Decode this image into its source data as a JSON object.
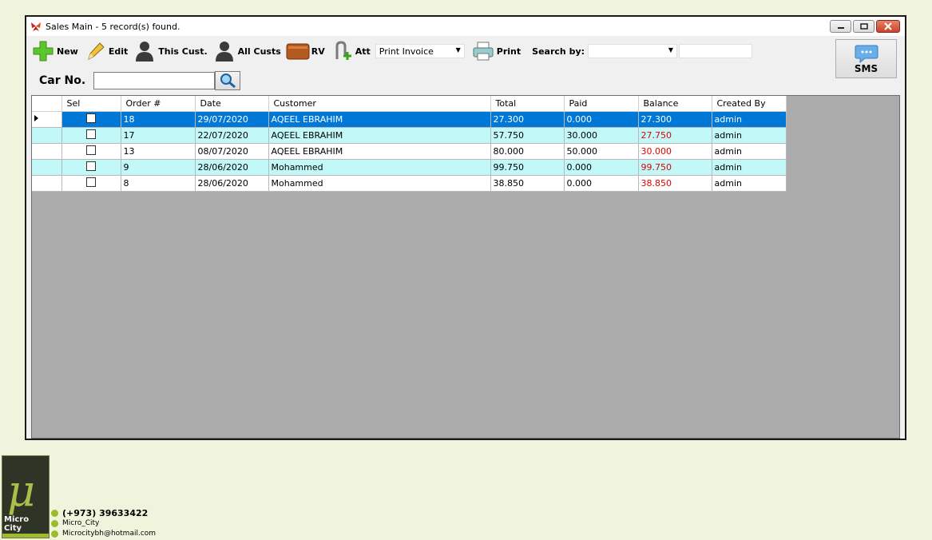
{
  "window": {
    "title": "Sales Main - 5 record(s) found."
  },
  "toolbar": {
    "new_label": "New",
    "edit_label": "Edit",
    "this_cust_label": "This Cust.",
    "all_custs_label": "All Custs",
    "rv_label": "RV",
    "att_label": "Att",
    "print_combo_value": "Print Invoice",
    "print_label": "Print",
    "search_by_label": "Search by:",
    "search_by_value": "",
    "search_value": ""
  },
  "sms": {
    "label": "SMS"
  },
  "carno": {
    "label": "Car No.",
    "value": ""
  },
  "grid": {
    "columns": [
      "Sel",
      "Order #",
      "Date",
      "Customer",
      "Total",
      "Paid",
      "Balance",
      "Created By"
    ],
    "rows": [
      {
        "order": "18",
        "date": "29/07/2020",
        "customer": "AQEEL EBRAHIM",
        "total": "27.300",
        "paid": "0.000",
        "balance": "27.300",
        "created_by": "admin"
      },
      {
        "order": "17",
        "date": "22/07/2020",
        "customer": "AQEEL EBRAHIM",
        "total": "57.750",
        "paid": "30.000",
        "balance": "27.750",
        "created_by": "admin"
      },
      {
        "order": "13",
        "date": "08/07/2020",
        "customer": "AQEEL EBRAHIM",
        "total": "80.000",
        "paid": "50.000",
        "balance": "30.000",
        "created_by": "admin"
      },
      {
        "order": "9",
        "date": "28/06/2020",
        "customer": "Mohammed",
        "total": "99.750",
        "paid": "0.000",
        "balance": "99.750",
        "created_by": "admin"
      },
      {
        "order": "8",
        "date": "28/06/2020",
        "customer": "Mohammed",
        "total": "38.850",
        "paid": "0.000",
        "balance": "38.850",
        "created_by": "admin"
      }
    ],
    "selected_row": 0
  },
  "colors": {
    "selection": "#0078d7",
    "alt_row": "#c3f8f8",
    "negative_balance": "#e00000",
    "background": "#f1f4dc"
  },
  "brand": {
    "logo_text": "Micro City",
    "phone": "(+973) 39633422",
    "handle": "Micro_City",
    "email": "Microcitybh@hotmail.com"
  }
}
